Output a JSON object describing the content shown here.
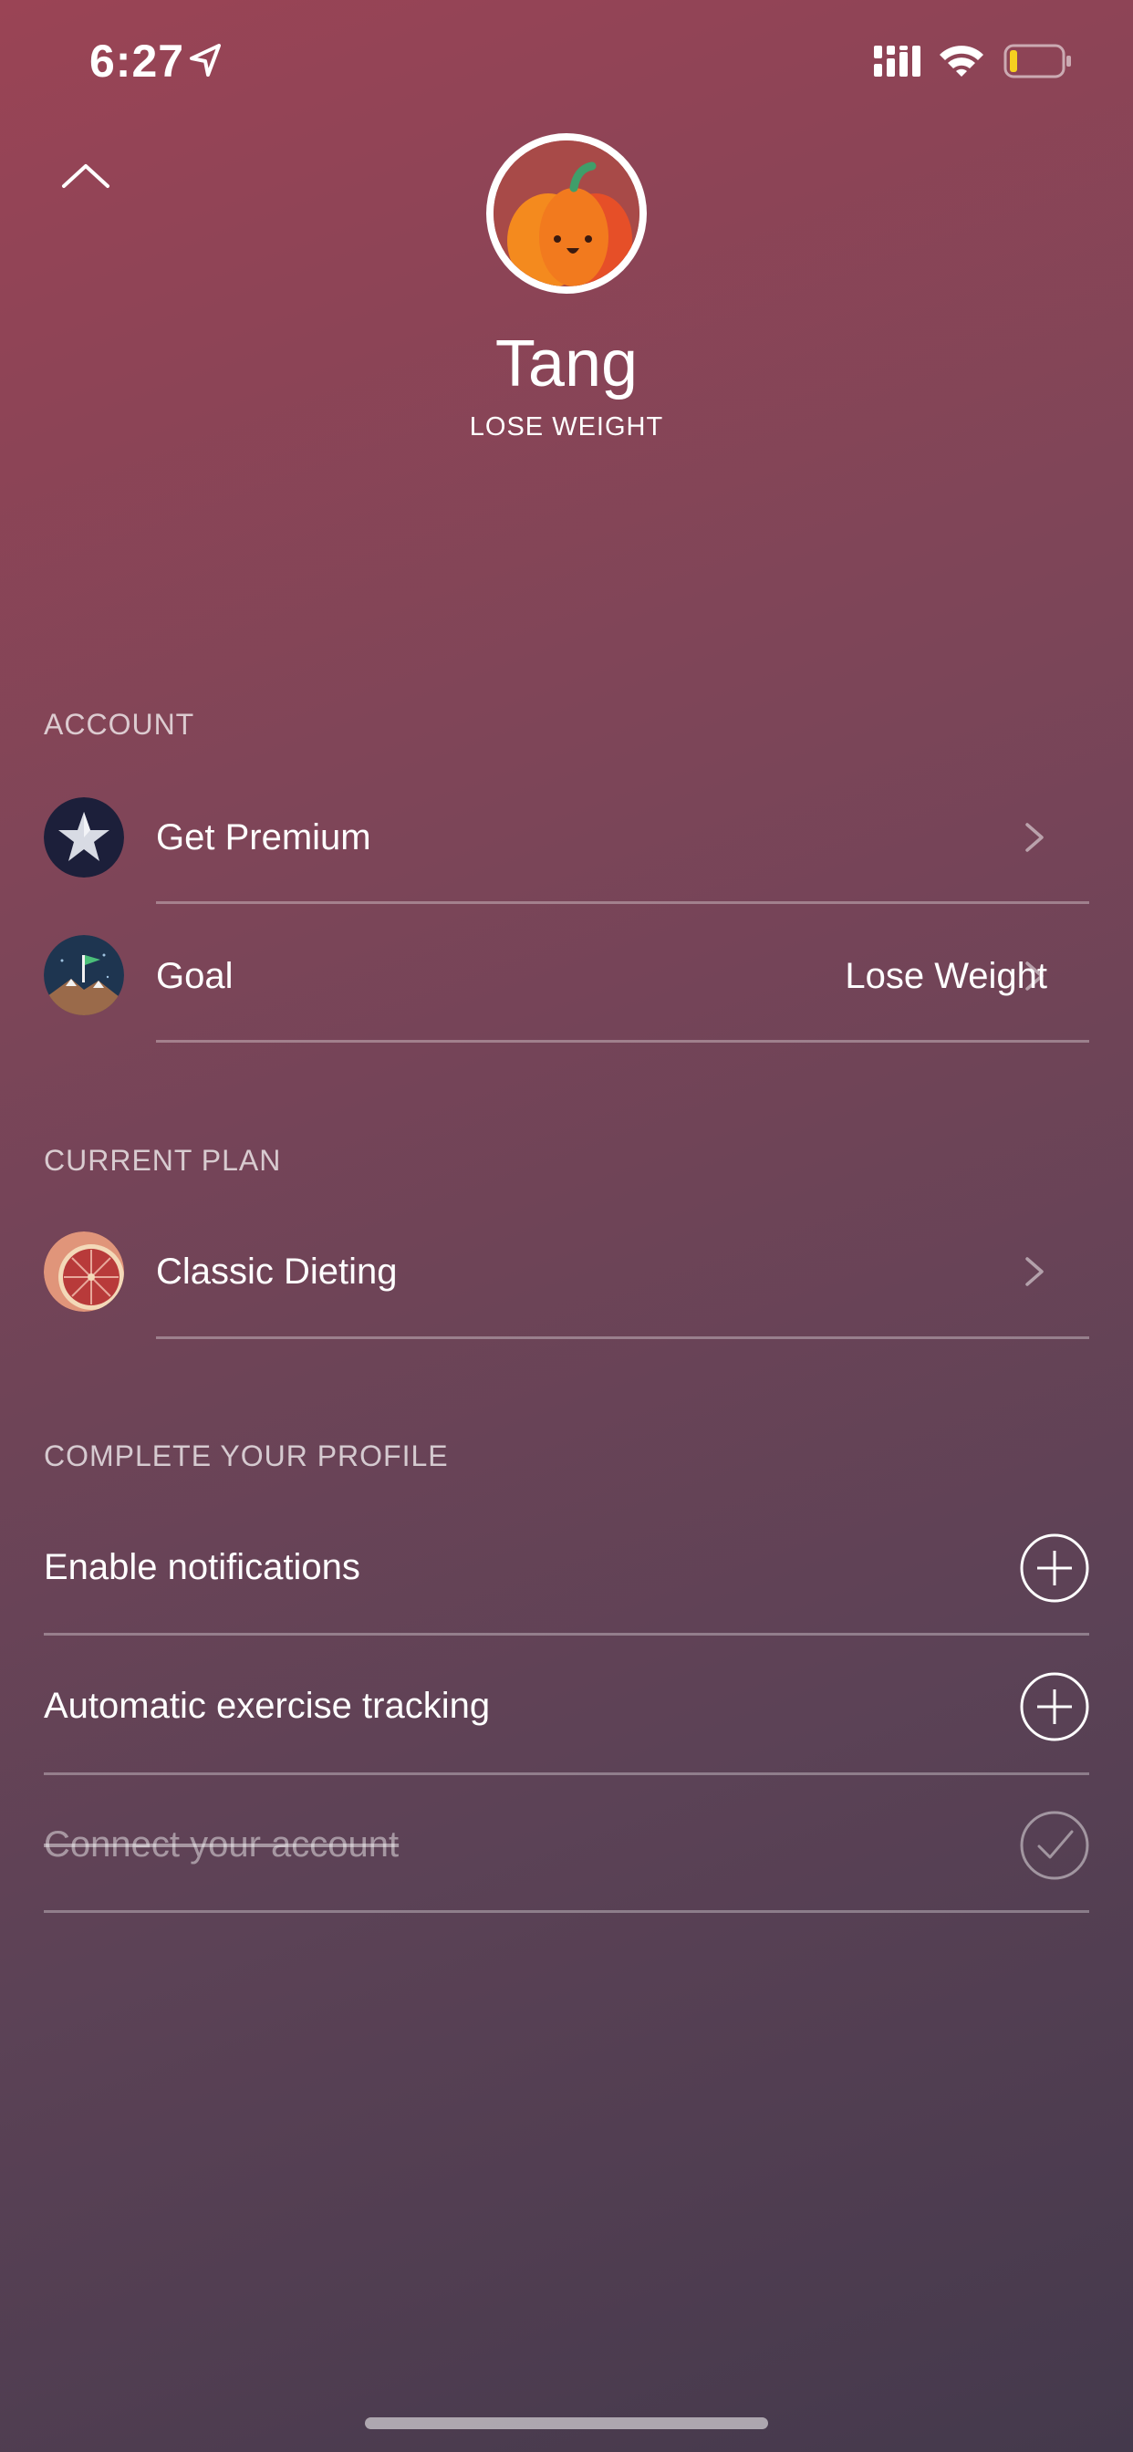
{
  "status_bar": {
    "time": "6:27"
  },
  "profile": {
    "name": "Tang",
    "goal": "LOSE WEIGHT"
  },
  "sections": {
    "account": {
      "title": "ACCOUNT",
      "items": [
        {
          "label": "Get Premium",
          "value": ""
        },
        {
          "label": "Goal",
          "value": "Lose Weight"
        }
      ]
    },
    "current_plan": {
      "title": "CURRENT PLAN",
      "items": [
        {
          "label": "Classic Dieting",
          "value": ""
        }
      ]
    },
    "complete_profile": {
      "title": "COMPLETE YOUR PROFILE",
      "items": [
        {
          "label": "Enable notifications",
          "state": "incomplete",
          "icon": "plus-circle-icon"
        },
        {
          "label": "Automatic exercise tracking",
          "state": "incomplete",
          "icon": "plus-circle-icon"
        },
        {
          "label": "Connect your account",
          "state": "completed",
          "icon": "check-circle-icon"
        }
      ]
    }
  },
  "colors": {
    "gradient_start": "#9a4455",
    "gradient_end": "#44394c",
    "battery_level": "#f5d020",
    "avatar_pumpkin": "#f07a22"
  },
  "battery_level": 0.15
}
